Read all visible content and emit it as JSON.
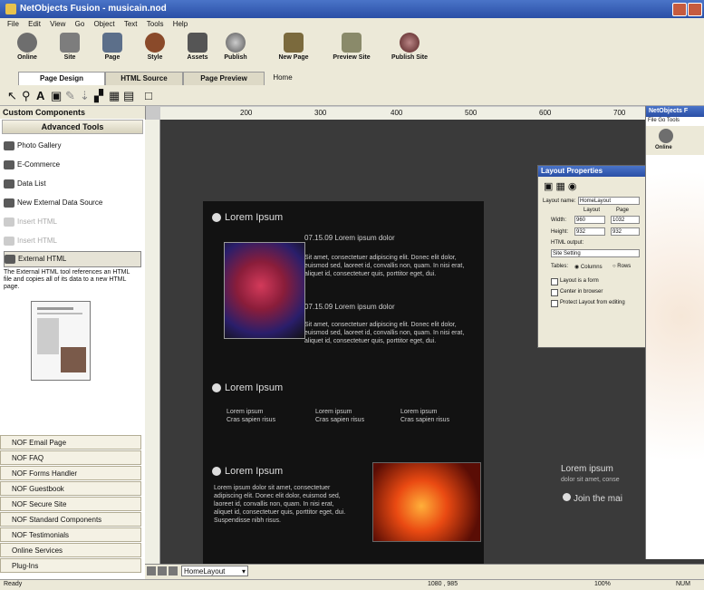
{
  "window": {
    "title": "NetObjects Fusion - musicain.nod"
  },
  "menu": [
    "File",
    "Edit",
    "View",
    "Go",
    "Object",
    "Text",
    "Tools",
    "Help"
  ],
  "main_toolbar": [
    {
      "label": "Online",
      "icon": "online-icon"
    },
    {
      "label": "Site",
      "icon": "site-icon"
    },
    {
      "label": "Page",
      "icon": "page-icon"
    },
    {
      "label": "Style",
      "icon": "style-icon"
    },
    {
      "label": "Assets",
      "icon": "assets-icon"
    },
    {
      "label": "Publish",
      "icon": "publish-icon"
    },
    {
      "label": "New Page",
      "icon": "new-page-icon"
    },
    {
      "label": "Preview Site",
      "icon": "preview-site-icon"
    },
    {
      "label": "Publish Site",
      "icon": "publish-site-icon"
    }
  ],
  "tabs": [
    "Page Design",
    "HTML Source",
    "Page Preview",
    "Home"
  ],
  "left_panel": {
    "title": "Custom Components",
    "subtitle": "Advanced Tools",
    "tools": [
      "Photo Gallery",
      "E-Commerce",
      "Data List",
      "New External Data Source",
      "Insert HTML",
      "Insert HTML",
      "External HTML"
    ],
    "description": "The External HTML tool references an HTML file and copies all of its data to a new HTML page.",
    "components": [
      "NOF Email Page",
      "NOF FAQ",
      "NOF Forms Handler",
      "NOF Guestbook",
      "NOF Secure Site",
      "NOF Standard Components",
      "NOF Testimonials",
      "Online Services",
      "Plug-Ins"
    ]
  },
  "ruler": [
    "200",
    "300",
    "400",
    "500",
    "600",
    "700"
  ],
  "page": {
    "sections": [
      {
        "title": "Lorem Ipsum"
      },
      {
        "title": "Lorem Ipsum"
      },
      {
        "title": "Lorem Ipsum"
      }
    ],
    "post1_date": "07.15.09  Lorem ipsum dolor",
    "post1_text": "Sit amet, consectetuer adipiscing elit. Donec elit dolor, euismod sed, laoreet id, convallis non, quam. In nisi erat, aliquet id, consectetuer quis, porttitor eget, dui.",
    "post2_date": "07.15.09  Lorem ipsum dolor",
    "post2_text": "Sit amet, consectetuer adipiscing elit. Donec elit dolor, euismod sed, laoreet id, convallis non, quam. In nisi erat, aliquet id, consectetuer quis, porttitor eget, dui.",
    "cols": [
      {
        "t": "Lorem ipsum",
        "s": "Cras sapien risus"
      },
      {
        "t": "Lorem ipsum",
        "s": "Cras sapien risus"
      },
      {
        "t": "Lorem ipsum",
        "s": "Cras sapien risus"
      }
    ],
    "block3_text": "Lorem ipsum dolor sit amet, consectetuer adipiscing elit. Donec elit dolor, euismod sed, laoreet id, convallis non, quam. In nisi erat, aliquet id, consectetuer quis, porttitor eget, dui. Suspendisse nibh risus.",
    "side_title": "Lorem ipsum",
    "side_sub": "dolor sit amet, conse",
    "join": "Join the mai"
  },
  "layout_properties": {
    "title": "Layout Properties",
    "layout_name_label": "Layout name:",
    "layout_name": "HomeLayout",
    "col_layout": "Layout",
    "col_page": "Page",
    "width_label": "Width:",
    "width_layout": "960",
    "width_page": "1032",
    "height_label": "Height:",
    "height_layout": "932",
    "height_page": "932",
    "html_output_label": "HTML output:",
    "html_output": "Site Setting",
    "tables_label": "Tables:",
    "opt_columns": "Columns",
    "opt_rows": "Rows",
    "chk1": "Layout is a form",
    "chk2": "Center in browser",
    "chk3": "Protect Layout from editing"
  },
  "win2": {
    "title": "NetObjects F",
    "menu": "File  Go  Tools",
    "btn": "Online"
  },
  "pagebar": {
    "layout": "HomeLayout"
  },
  "status": {
    "left": "Ready",
    "coords": "1080 , 985",
    "zoom": "100%",
    "num": "NUM"
  }
}
